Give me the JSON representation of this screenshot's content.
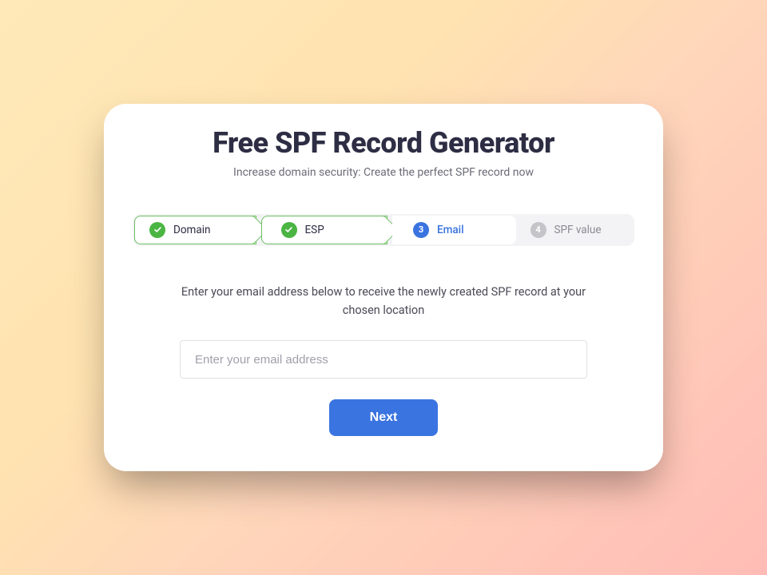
{
  "header": {
    "title": "Free SPF Record Generator",
    "subtitle": "Increase domain security: Create the perfect SPF record now"
  },
  "stepper": {
    "steps": [
      {
        "label": "Domain",
        "state": "done"
      },
      {
        "label": "ESP",
        "state": "done"
      },
      {
        "label": "Email",
        "state": "current",
        "number": "3"
      },
      {
        "label": "SPF value",
        "state": "pending",
        "number": "4"
      }
    ]
  },
  "content": {
    "prompt": "Enter your email address below to receive the newly created SPF record at your chosen location",
    "email_placeholder": "Enter your email address",
    "email_value": "",
    "next_label": "Next"
  },
  "colors": {
    "accent_blue": "#3a74e0",
    "accent_green": "#4bb543"
  }
}
